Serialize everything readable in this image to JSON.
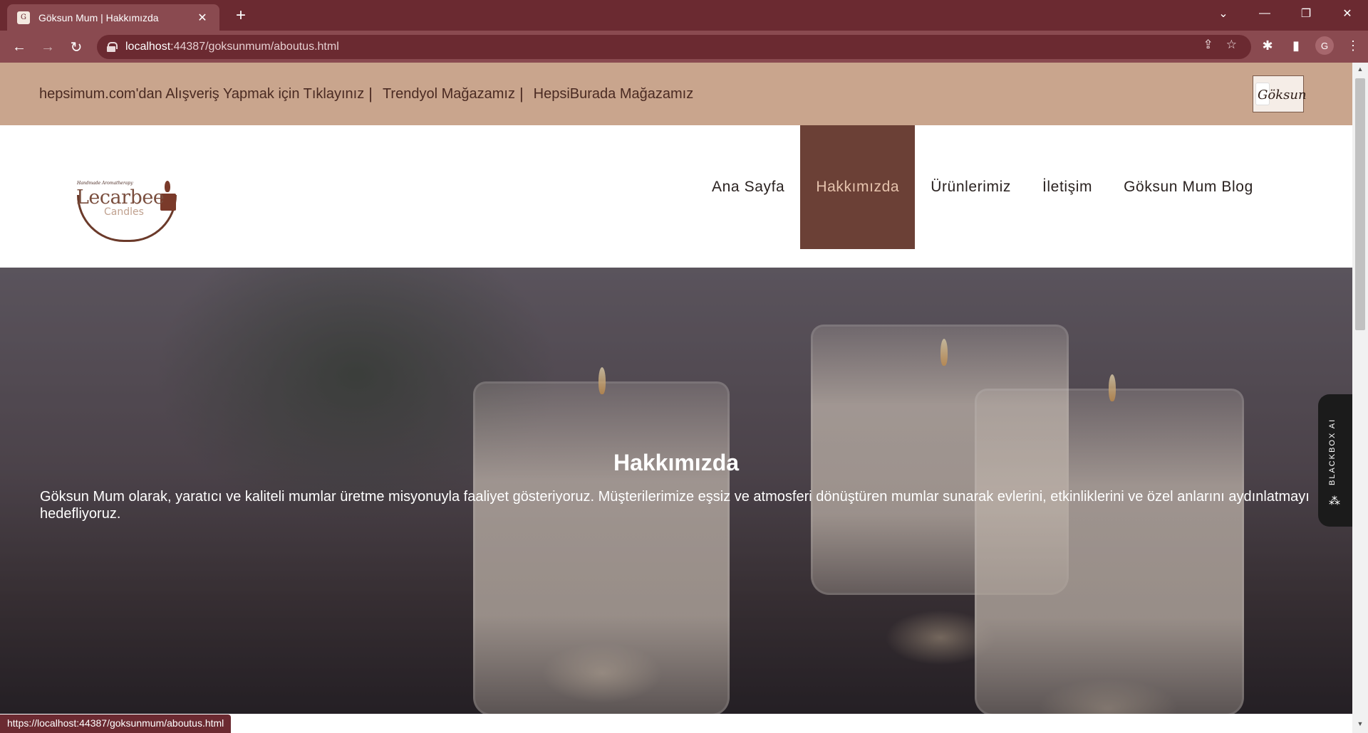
{
  "browser": {
    "tab_title": "Göksun Mum | Hakkımızda",
    "url_host": "localhost",
    "url_rest": ":44387/goksunmum/aboutus.html",
    "profile_initial": "G",
    "status_url": "https://localhost:44387/goksunmum/aboutus.html"
  },
  "topbar": {
    "links": [
      "hepsimum.com'dan Alışveriş Yapmak için Tıklayınız",
      "Trendyol Mağazamız",
      "HepsiBurada Mağazamız"
    ],
    "separator": "|"
  },
  "brand": {
    "tagline": "Handmade Aromatherapy",
    "name": "Lecarbee",
    "sub": "Candles"
  },
  "menu": {
    "items": [
      "Ana Sayfa",
      "Hakkımızda",
      "Ürünlerimiz",
      "İletişim",
      "Göksun Mum Blog"
    ],
    "active_index": 1
  },
  "hero": {
    "title": "Hakkımızda",
    "text": "Göksun Mum olarak, yaratıcı ve kaliteli mumlar üretme misyonuyla faaliyet gösteriyoruz. Müşterilerimize eşsiz ve atmosferi dönüştüren mumlar sunarak evlerini, etkinliklerini ve özel anlarını aydınlatmayı hedefliyoruz."
  },
  "sidebar_widget": {
    "label": "BLACKBOX AI"
  },
  "colors": {
    "browser_frame": "#6b2a31",
    "topbar_bg": "#c9a58d",
    "menu_active_bg": "#6b4036",
    "menu_active_text": "#e6c3ad"
  }
}
